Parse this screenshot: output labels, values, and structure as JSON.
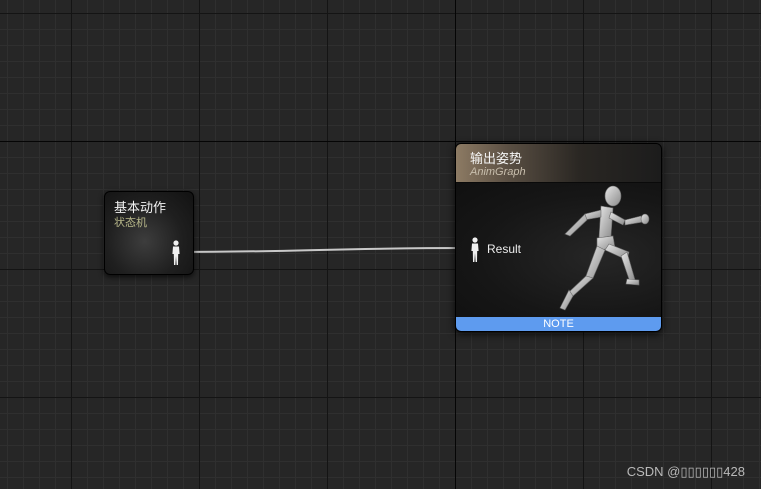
{
  "state_machine_node": {
    "title": "基本动作",
    "subtitle": "状态机",
    "pin_icon": "pose-pin-icon"
  },
  "output_pose_node": {
    "title": "输出姿势",
    "subtitle": "AnimGraph",
    "pin_icon": "pose-pin-icon",
    "pin_label": "Result",
    "preview_icon": "running-mannequin-icon",
    "footer_label": "NOTE",
    "footer_color": "#5e9bef"
  },
  "colors": {
    "background": "#262626",
    "wire": "#c8c8c8",
    "header_accent": "#8d7b64"
  },
  "watermark": "CSDN @▯▯▯▯▯▯428"
}
